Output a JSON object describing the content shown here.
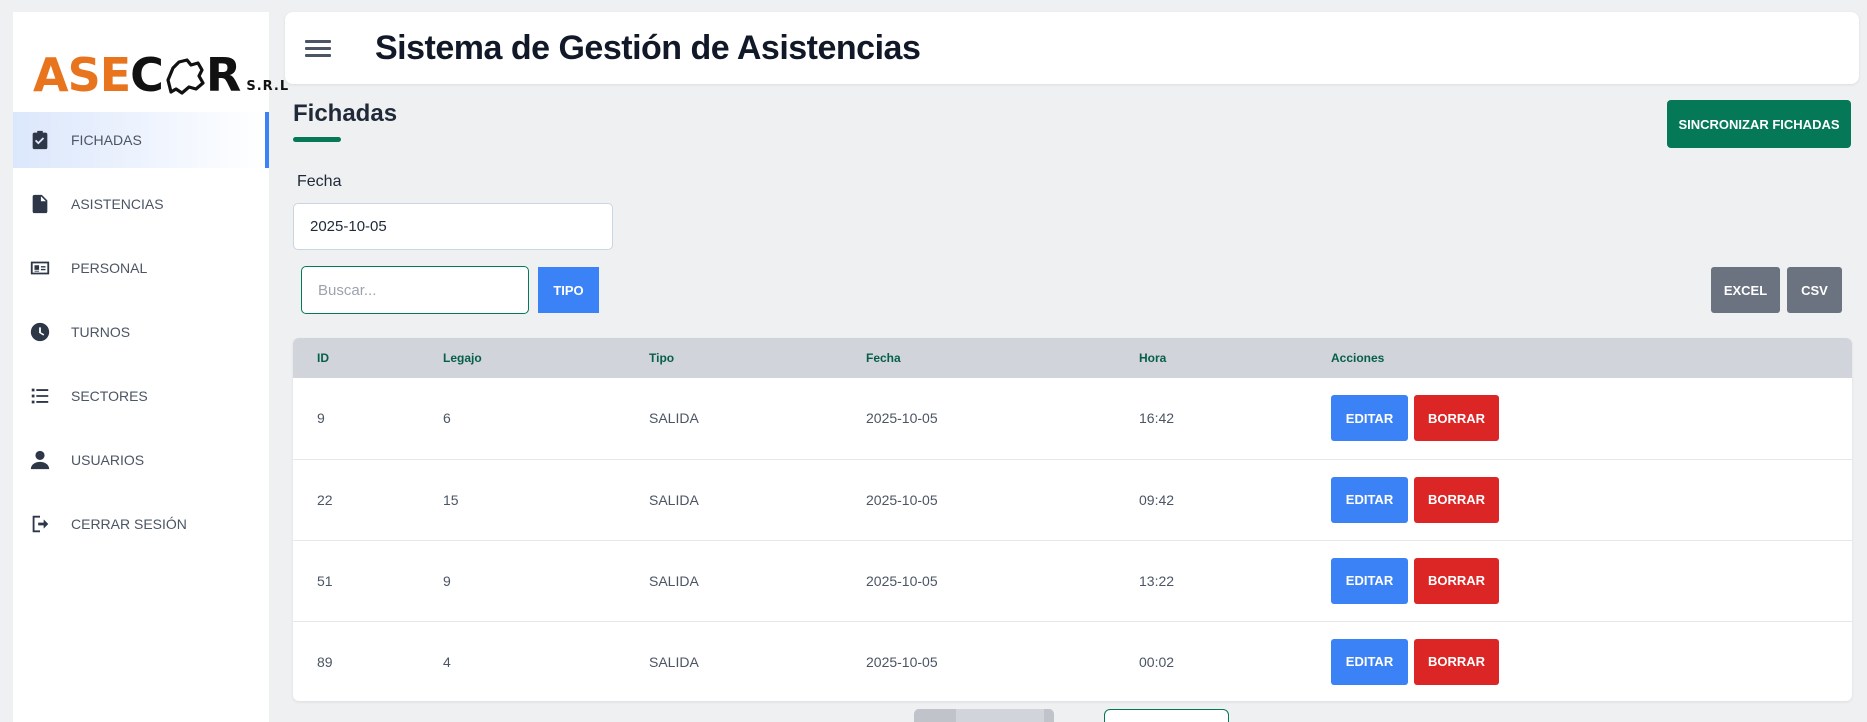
{
  "logo": {
    "text_ase": "ASE",
    "text_c": "C",
    "text_r": "R",
    "text_srl": "S.R.L"
  },
  "sidebar": {
    "items": [
      {
        "label": "FICHADAS",
        "icon": "clipboard-check-icon",
        "active": true
      },
      {
        "label": "ASISTENCIAS",
        "icon": "file-icon",
        "active": false
      },
      {
        "label": "PERSONAL",
        "icon": "id-card-icon",
        "active": false
      },
      {
        "label": "TURNOS",
        "icon": "clock-icon",
        "active": false
      },
      {
        "label": "SECTORES",
        "icon": "list-icon",
        "active": false
      },
      {
        "label": "USUARIOS",
        "icon": "user-icon",
        "active": false
      },
      {
        "label": "CERRAR SESIÓN",
        "icon": "logout-icon",
        "active": false
      }
    ]
  },
  "header": {
    "title": "Sistema de Gestión de Asistencias"
  },
  "main": {
    "page_title": "Fichadas",
    "sync_label": "SINCRONIZAR FICHADAS",
    "fecha_label": "Fecha",
    "fecha_value": "2025-10-05",
    "search_placeholder": "Buscar...",
    "tipo_label": "TIPO",
    "excel_label": "EXCEL",
    "csv_label": "CSV"
  },
  "table": {
    "headers": {
      "id": "ID",
      "legajo": "Legajo",
      "tipo": "Tipo",
      "fecha": "Fecha",
      "hora": "Hora",
      "acciones": "Acciones"
    },
    "edit_label": "EDITAR",
    "delete_label": "BORRAR",
    "rows": [
      {
        "id": "9",
        "legajo": "6",
        "tipo": "SALIDA",
        "fecha": "2025-10-05",
        "hora": "16:42"
      },
      {
        "id": "22",
        "legajo": "15",
        "tipo": "SALIDA",
        "fecha": "2025-10-05",
        "hora": "09:42"
      },
      {
        "id": "51",
        "legajo": "9",
        "tipo": "SALIDA",
        "fecha": "2025-10-05",
        "hora": "13:22"
      },
      {
        "id": "89",
        "legajo": "4",
        "tipo": "SALIDA",
        "fecha": "2025-10-05",
        "hora": "00:02"
      }
    ]
  },
  "colors": {
    "accent": "#047857",
    "primary": "#3b82f6",
    "danger": "#dc2626",
    "neutral": "#6b7280",
    "logo_orange": "#e8741d"
  }
}
